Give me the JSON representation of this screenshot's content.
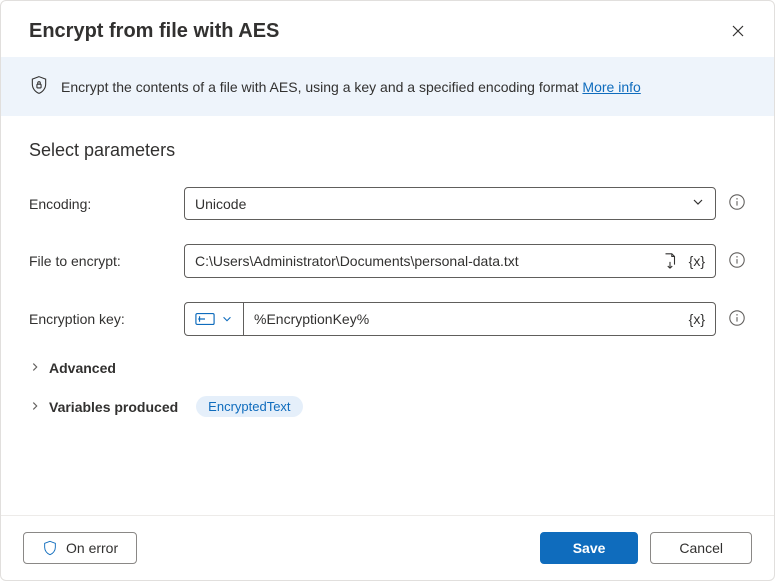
{
  "header": {
    "title": "Encrypt from file with AES"
  },
  "banner": {
    "text": "Encrypt the contents of a file with AES, using a key and a specified encoding format ",
    "link": "More info"
  },
  "section": {
    "title": "Select parameters"
  },
  "params": {
    "encoding": {
      "label": "Encoding:",
      "value": "Unicode"
    },
    "file": {
      "label": "File to encrypt:",
      "value": "C:\\Users\\Administrator\\Documents\\personal-data.txt"
    },
    "key": {
      "label": "Encryption key:",
      "value": "%EncryptionKey%"
    }
  },
  "expandables": {
    "advanced": "Advanced",
    "variables": "Variables produced",
    "variableChip": "EncryptedText"
  },
  "footer": {
    "onError": "On error",
    "save": "Save",
    "cancel": "Cancel"
  }
}
